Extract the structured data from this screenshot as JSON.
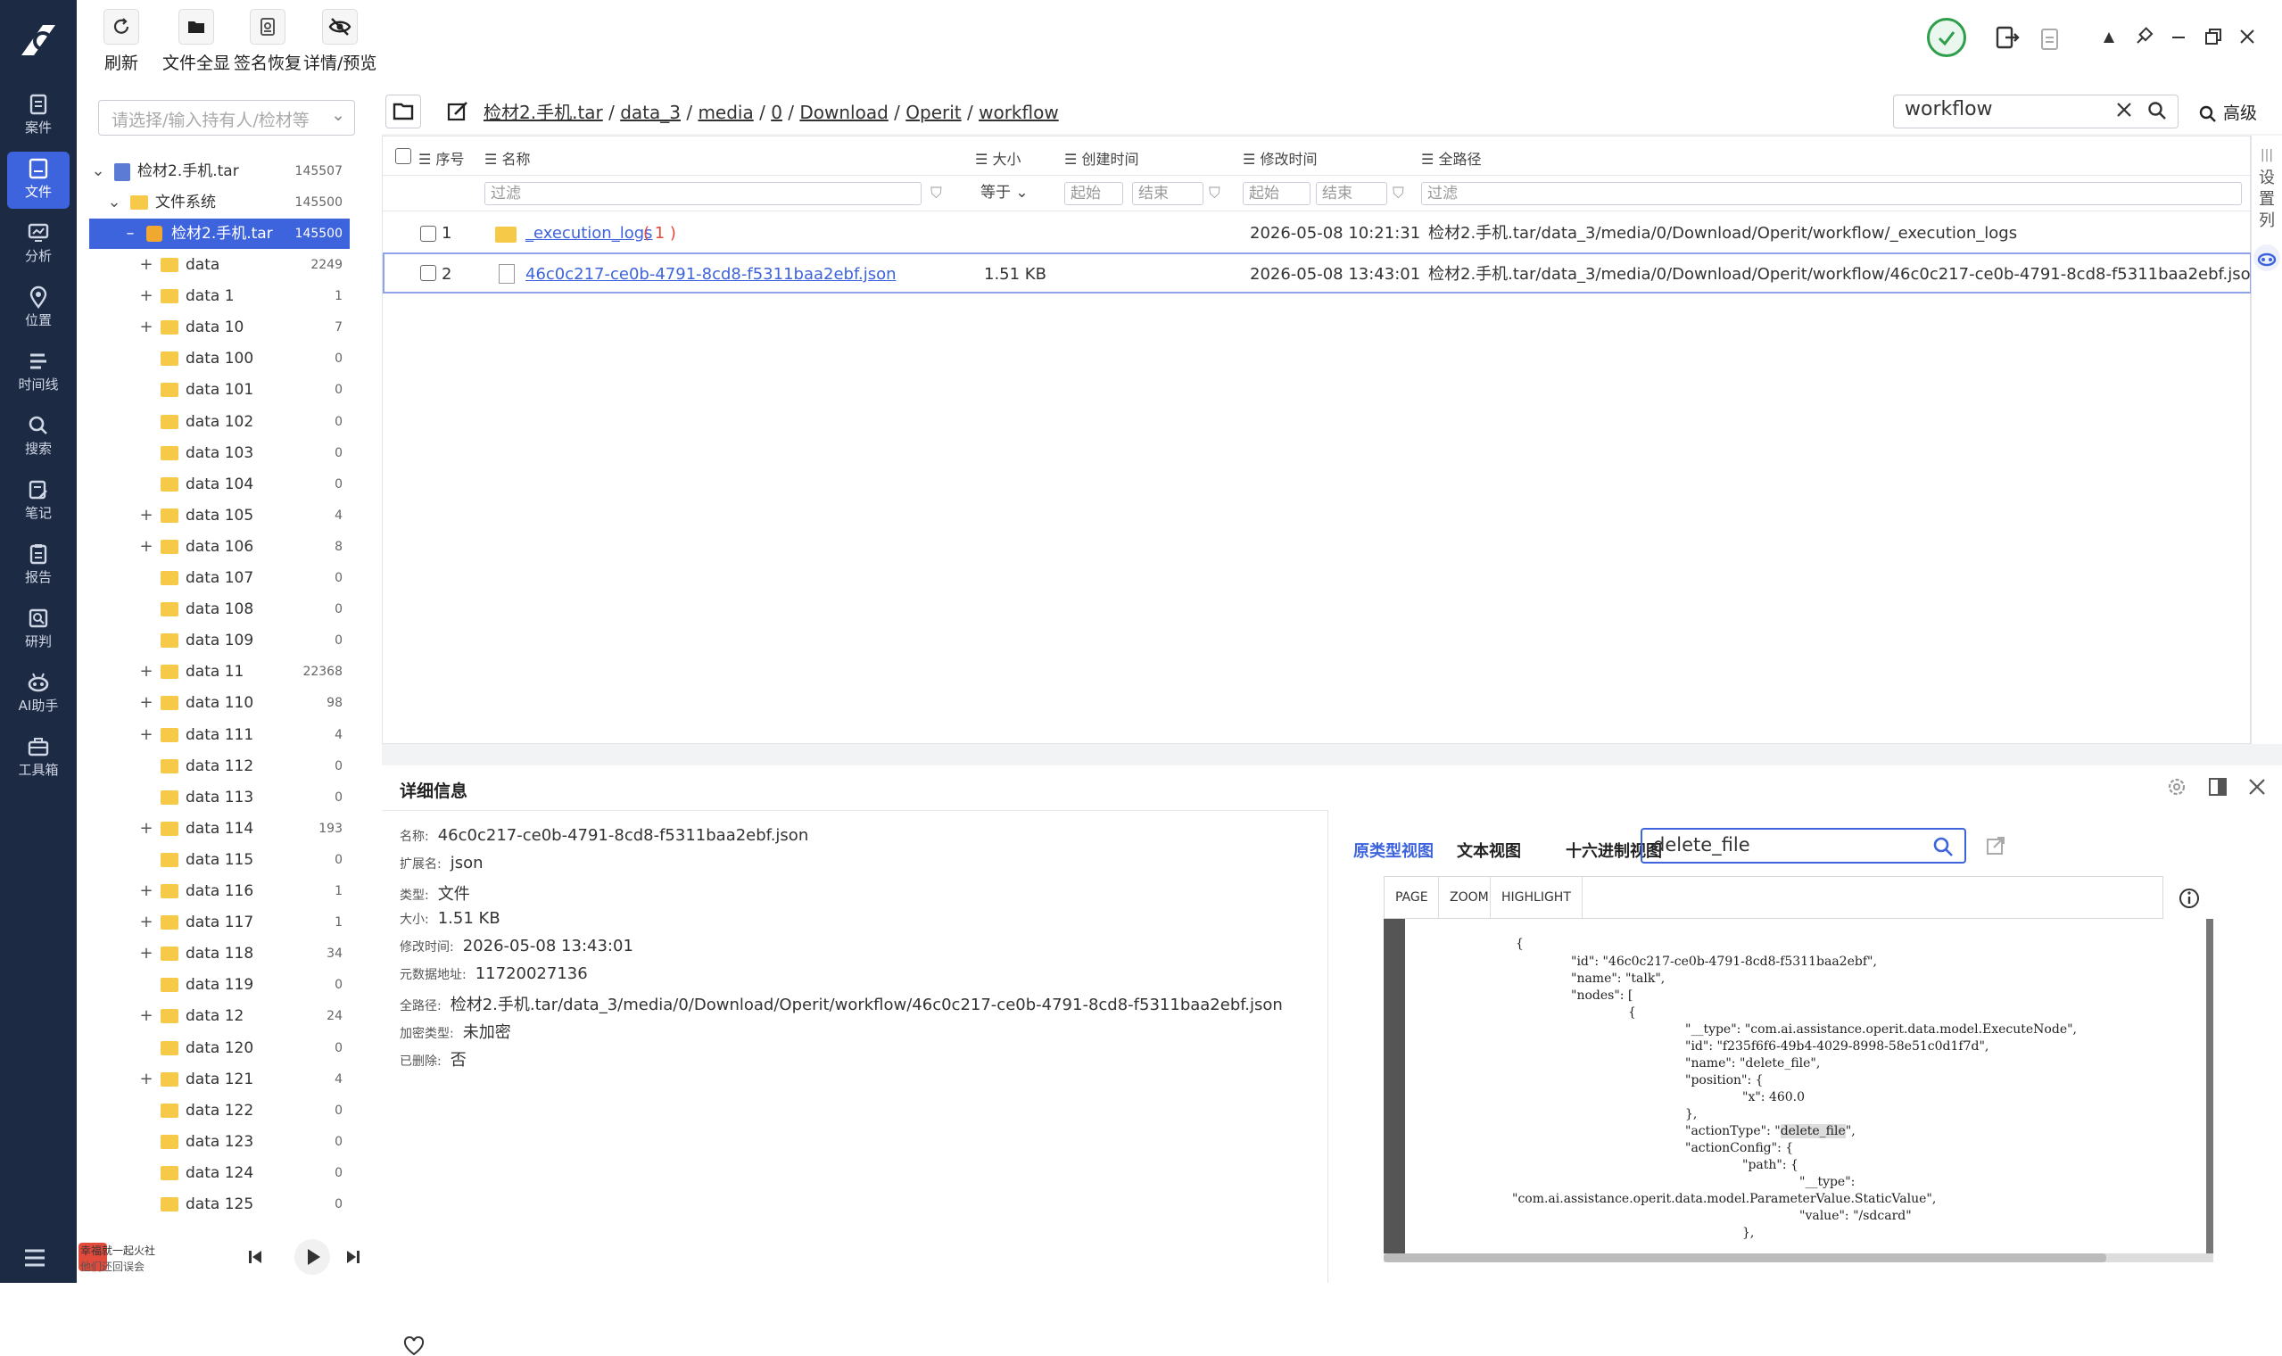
{
  "toolbar": {
    "refresh": "刷新",
    "full_view": "文件全显",
    "sig_recover": "签名恢复",
    "detail_preview": "详情/预览"
  },
  "rail": {
    "items": [
      {
        "label": "案件",
        "icon": "case-icon"
      },
      {
        "label": "文件",
        "icon": "file-icon"
      },
      {
        "label": "分析",
        "icon": "analysis-icon"
      },
      {
        "label": "位置",
        "icon": "location-icon"
      },
      {
        "label": "时间线",
        "icon": "timeline-icon"
      },
      {
        "label": "搜索",
        "icon": "search-icon"
      },
      {
        "label": "笔记",
        "icon": "note-icon"
      },
      {
        "label": "报告",
        "icon": "report-icon"
      },
      {
        "label": "研判",
        "icon": "judge-icon"
      },
      {
        "label": "AI助手",
        "icon": "ai-assistant-icon"
      },
      {
        "label": "工具箱",
        "icon": "toolbox-icon"
      }
    ]
  },
  "holder": {
    "placeholder": "请选择/输入持有人/检材等"
  },
  "tree": {
    "root": {
      "name": "检材2.手机.tar",
      "count": "145507"
    },
    "fs": {
      "name": "文件系统",
      "count": "145500"
    },
    "selected": {
      "name": "检材2.手机.tar",
      "count": "145500"
    },
    "items": [
      {
        "name": "data",
        "count": "2249",
        "exp": "+"
      },
      {
        "name": "data 1",
        "count": "1",
        "exp": "+"
      },
      {
        "name": "data 10",
        "count": "7",
        "exp": "+"
      },
      {
        "name": "data 100",
        "count": "0",
        "exp": ""
      },
      {
        "name": "data 101",
        "count": "0",
        "exp": ""
      },
      {
        "name": "data 102",
        "count": "0",
        "exp": ""
      },
      {
        "name": "data 103",
        "count": "0",
        "exp": ""
      },
      {
        "name": "data 104",
        "count": "0",
        "exp": ""
      },
      {
        "name": "data 105",
        "count": "4",
        "exp": "+"
      },
      {
        "name": "data 106",
        "count": "8",
        "exp": "+"
      },
      {
        "name": "data 107",
        "count": "0",
        "exp": ""
      },
      {
        "name": "data 108",
        "count": "0",
        "exp": ""
      },
      {
        "name": "data 109",
        "count": "0",
        "exp": ""
      },
      {
        "name": "data 11",
        "count": "22368",
        "exp": "+"
      },
      {
        "name": "data 110",
        "count": "98",
        "exp": "+"
      },
      {
        "name": "data 111",
        "count": "4",
        "exp": "+"
      },
      {
        "name": "data 112",
        "count": "0",
        "exp": ""
      },
      {
        "name": "data 113",
        "count": "0",
        "exp": ""
      },
      {
        "name": "data 114",
        "count": "193",
        "exp": "+"
      },
      {
        "name": "data 115",
        "count": "0",
        "exp": ""
      },
      {
        "name": "data 116",
        "count": "1",
        "exp": "+"
      },
      {
        "name": "data 117",
        "count": "1",
        "exp": "+"
      },
      {
        "name": "data 118",
        "count": "34",
        "exp": "+"
      },
      {
        "name": "data 119",
        "count": "0",
        "exp": ""
      },
      {
        "name": "data 12",
        "count": "24",
        "exp": "+"
      },
      {
        "name": "data 120",
        "count": "0",
        "exp": ""
      },
      {
        "name": "data 121",
        "count": "4",
        "exp": "+"
      },
      {
        "name": "data 122",
        "count": "0",
        "exp": ""
      },
      {
        "name": "data 123",
        "count": "0",
        "exp": ""
      },
      {
        "name": "data 124",
        "count": "0",
        "exp": ""
      },
      {
        "name": "data 125",
        "count": "0",
        "exp": ""
      }
    ]
  },
  "player": {
    "line1": "幸福就一起火社",
    "line2": "他们还回误会"
  },
  "breadcrumb": [
    "检材2.手机.tar",
    "data_3",
    "media",
    "0",
    "Download",
    "Operit",
    "workflow"
  ],
  "search": {
    "value": "workflow",
    "advanced": "高级"
  },
  "grid": {
    "headers": {
      "index": "序号",
      "name": "名称",
      "size": "大小",
      "created": "创建时间",
      "modified": "修改时间",
      "path": "全路径"
    },
    "filters": {
      "filter": "过滤",
      "equals": "等于",
      "start": "起始",
      "end": "结束"
    },
    "rows": [
      {
        "index": "1",
        "name": "_execution_logs",
        "badge": "( 1 )",
        "size": "",
        "created": "",
        "modified": "2026-05-08 10:21:31",
        "path": "检材2.手机.tar/data_3/media/0/Download/Operit/workflow/_execution_logs"
      },
      {
        "index": "2",
        "name": "46c0c217-ce0b-4791-8cd8-f5311baa2ebf.json",
        "badge": "",
        "size": "1.51 KB",
        "created": "",
        "modified": "2026-05-08 13:43:01",
        "path": "检材2.手机.tar/data_3/media/0/Download/Operit/workflow/46c0c217-ce0b-4791-8cd8-f5311baa2ebf.json"
      }
    ],
    "side_tab": "设置列"
  },
  "detail": {
    "title": "详细信息",
    "fields": [
      {
        "k": "名称:",
        "v": "46c0c217-ce0b-4791-8cd8-f5311baa2ebf.json"
      },
      {
        "k": "扩展名:",
        "v": "json"
      },
      {
        "k": "类型:",
        "v": "文件"
      },
      {
        "k": "大小:",
        "v": "1.51 KB"
      },
      {
        "k": "修改时间:",
        "v": "2026-05-08 13:43:01"
      },
      {
        "k": "元数据地址:",
        "v": "11720027136"
      },
      {
        "k": "全路径:",
        "v": "检材2.手机.tar/data_3/media/0/Download/Operit/workflow/46c0c217-ce0b-4791-8cd8-f5311baa2ebf.json"
      },
      {
        "k": "加密类型:",
        "v": "未加密"
      },
      {
        "k": "已删除:",
        "v": "否"
      }
    ]
  },
  "viewer": {
    "tabs": [
      "原类型视图",
      "文本视图",
      "十六进制视图"
    ],
    "search": "delete_file",
    "bar": [
      "PAGE",
      "ZOOM",
      "HIGHLIGHT"
    ],
    "code": [
      "{",
      "\"id\": \"46c0c217-ce0b-4791-8cd8-f5311baa2ebf\",",
      "\"name\": \"talk\",",
      "\"nodes\": [",
      "{",
      "\"__type\": \"com.ai.assistance.operit.data.model.ExecuteNode\",",
      "\"id\": \"f235f6f6-49b4-4029-8998-58e51c0d1f7d\",",
      "\"name\": \"delete_file\",",
      "\"position\": {",
      "\"x\": 460.0",
      "},",
      "\"actionType\": \"",
      "delete_file",
      "\",",
      "\"actionConfig\": {",
      "\"path\": {",
      "\"__type\":",
      "\"com.ai.assistance.operit.data.model.ParameterValue.StaticValue\",",
      "\"value\": \"/sdcard\"",
      "},"
    ]
  }
}
